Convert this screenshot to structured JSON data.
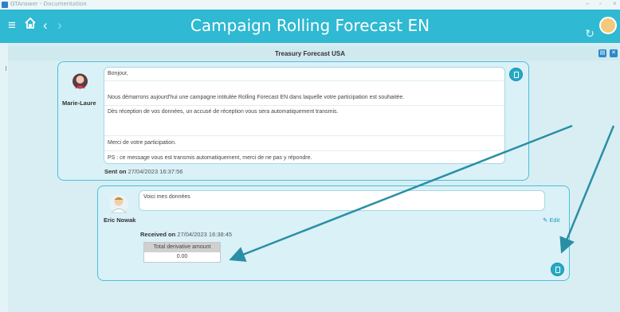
{
  "os": {
    "title": "GTAnswer - Documentation"
  },
  "header": {
    "title": "Campaign Rolling Forecast EN"
  },
  "form": {
    "title": "Treasury Forecast USA"
  },
  "message1": {
    "author": "Marie-Laure",
    "lines": [
      "Bonjour,",
      "Nous démarrons aujourd'hui une campagne intitulée Rolling Forecast EN dans laquelle votre participation est souhaitée.",
      "Dès réception de vos données, un accusé de réception vous sera automatiquement transmis.",
      "",
      "Merci de votre participation.",
      "PS : ce message vous est transmis automatiquement, merci de ne pas y répondre."
    ],
    "sent_label": "Sent on",
    "sent_date": "27/04/2023 16:37:56"
  },
  "message2": {
    "author": "Eric Nowak",
    "text": "Voici mes données",
    "received_label": "Received on",
    "received_date": "27/04/2023 16:38:45",
    "edit_label": "Edit",
    "table": {
      "header": "Total derivative amount",
      "value": "0.00"
    }
  },
  "colors": {
    "header": "#2fb9d2",
    "card_border": "#4cc0db",
    "arrow": "#2a8ea4"
  }
}
